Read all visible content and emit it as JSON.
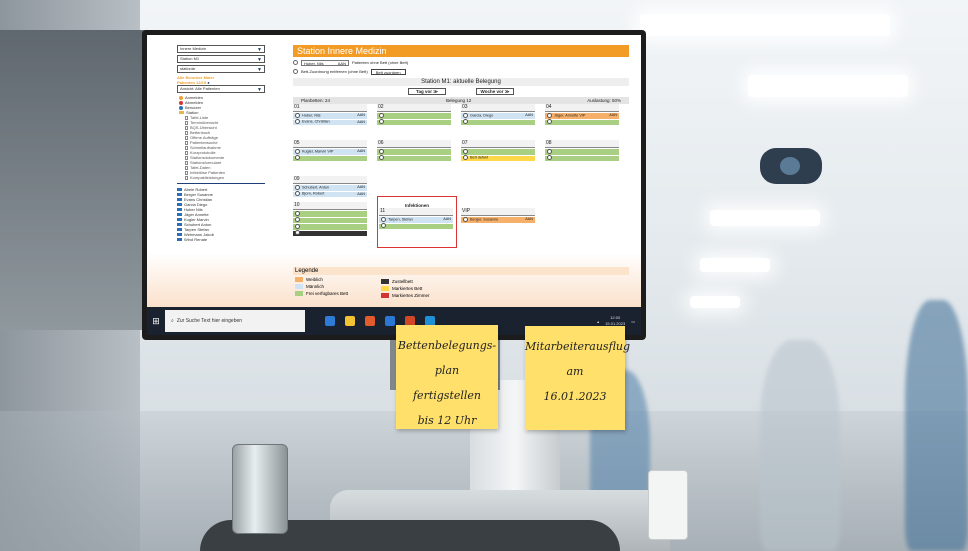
{
  "sidebar": {
    "select_1": "Innere Medizin",
    "select_2": "Station M1",
    "select_3": "stationär",
    "orange_line_1": "Alle Benutzer Maier",
    "orange_line_2": "Patienten 12/19",
    "select_4": "Ansicht: Alle Patienten",
    "tree": [
      {
        "label": "Anmelden",
        "type": "dot",
        "color": "#f0a030"
      },
      {
        "label": "Abmelden",
        "type": "dot",
        "color": "#d33"
      },
      {
        "label": "Benutzer",
        "type": "dot",
        "color": "#2c6fb7"
      },
      {
        "label": "Station",
        "type": "folder"
      },
      {
        "label": "Tafel-Liste",
        "type": "doc",
        "sub": true
      },
      {
        "label": "Terminübersicht",
        "type": "doc",
        "sub": true
      },
      {
        "label": "BQS-Übersicht",
        "type": "doc",
        "sub": true
      },
      {
        "label": "Bettenbuch",
        "type": "doc",
        "sub": true
      },
      {
        "label": "Offene Aufträge",
        "type": "doc",
        "sub": true
      },
      {
        "label": "Patientensuche",
        "type": "doc",
        "sub": true
      },
      {
        "label": "Schnellaufnahme",
        "type": "doc",
        "sub": true
      },
      {
        "label": "Kurzprotokolle",
        "type": "doc",
        "sub": true
      },
      {
        "label": "Stationsdokumente",
        "type": "doc",
        "sub": true
      },
      {
        "label": "Stationsformulare",
        "type": "doc",
        "sub": true
      },
      {
        "label": "Tafel-Daten",
        "type": "doc",
        "sub": true
      },
      {
        "label": "Infektiöse Patienten",
        "type": "doc",
        "sub": true
      },
      {
        "label": "Kompaktleistungen",
        "type": "doc",
        "sub": true
      }
    ],
    "patients": [
      "Abele Robert",
      "Berger Susanne",
      "Evans Christian",
      "Garcia Diego",
      "Huber Nils",
      "Jäger Annette",
      "Kugler Marvin",
      "Schubert Anton",
      "Tarpen Stefan",
      "Wehmann Jakob",
      "Wind Renate"
    ]
  },
  "main": {
    "title": "Station Innere Medizin",
    "radio_select": "Huber, Nils",
    "radio_select_code": "AAN",
    "radio_1_text": "Patienten ohne Bett (ohne Bett)",
    "radio_2_text": "Bett-Zuordnung entfernen (ohne Bett)",
    "assign_button": "Bett zuordnen",
    "ward_heading": "Station M1: aktuelle Belegung",
    "day_forward": "Tag vor ≫",
    "week_forward": "Woche vor ≫",
    "stats": {
      "planned": "Planbetten: 24",
      "occupancy": "Belegung 12",
      "utilization": "Auslastung: 50%"
    }
  },
  "rooms": [
    {
      "num": "01",
      "beds": [
        {
          "name": "Huber, Nils",
          "code": "AAN",
          "kind": "male"
        },
        {
          "name": "Evans, Christian",
          "code": "AAN",
          "kind": "male"
        }
      ]
    },
    {
      "num": "02",
      "beds": [
        {
          "name": "",
          "code": "",
          "kind": "free"
        },
        {
          "name": "",
          "code": "",
          "kind": "free"
        }
      ]
    },
    {
      "num": "03",
      "beds": [
        {
          "name": "Garcia, Diego",
          "code": "AAN",
          "kind": "male"
        },
        {
          "name": "",
          "code": "",
          "kind": "free"
        }
      ]
    },
    {
      "num": "04",
      "beds": [
        {
          "name": "Jäger, Annette VIP",
          "code": "AAN",
          "kind": "female"
        },
        {
          "name": "",
          "code": "",
          "kind": "free"
        }
      ]
    },
    {
      "num": "05",
      "beds": [
        {
          "name": "Kugler, Marvin VIP",
          "code": "AAN",
          "kind": "male"
        },
        {
          "name": "",
          "code": "",
          "kind": "free"
        }
      ]
    },
    {
      "num": "06",
      "beds": [
        {
          "name": "",
          "code": "",
          "kind": "free"
        },
        {
          "name": "",
          "code": "",
          "kind": "free"
        }
      ]
    },
    {
      "num": "07",
      "beds": [
        {
          "name": "",
          "code": "",
          "kind": "free"
        },
        {
          "name": "Bett defekt",
          "code": "",
          "kind": "marked"
        }
      ]
    },
    {
      "num": "08",
      "beds": [
        {
          "name": "",
          "code": "",
          "kind": "free"
        },
        {
          "name": "",
          "code": "",
          "kind": "free"
        }
      ]
    },
    {
      "num": "09",
      "beds": [
        {
          "name": "Schubert, Anton",
          "code": "AAN",
          "kind": "male"
        },
        {
          "name": "Bjorn, Robert",
          "code": "AAN",
          "kind": "male"
        }
      ]
    },
    {
      "num": "10",
      "beds": [
        {
          "name": "",
          "code": "",
          "kind": "free"
        },
        {
          "name": "",
          "code": "",
          "kind": "free"
        },
        {
          "name": "",
          "code": "",
          "kind": "free"
        },
        {
          "name": "",
          "code": "",
          "kind": "extra"
        }
      ]
    },
    {
      "num": "11",
      "beds": [
        {
          "name": "Tarpen, Stefan",
          "code": "AAN",
          "kind": "male"
        },
        {
          "name": "",
          "code": "",
          "kind": "free"
        }
      ]
    },
    {
      "num": "VIP",
      "beds": [
        {
          "name": "Berger, Susanne",
          "code": "AAN",
          "kind": "female"
        }
      ]
    }
  ],
  "infection_title": "Infektionen",
  "legend": {
    "title": "Legende",
    "items": [
      {
        "label": "Weiblich",
        "color": "#f7b06a"
      },
      {
        "label": "Männlich",
        "color": "#cfe3f2"
      },
      {
        "label": "Frei verfügbares Bett",
        "color": "#a9cf83"
      },
      {
        "label": "Zustellbett",
        "color": "#333333"
      },
      {
        "label": "Markiertes Bett",
        "color": "#ffd84a"
      },
      {
        "label": "Markiertes Zimmer",
        "color": "#d33333"
      }
    ]
  },
  "taskbar": {
    "search_placeholder": "Zur Suche Text hier eingeben",
    "time": "12:00",
    "date": "15.01.2023"
  },
  "notes": {
    "note1": [
      "Bettenbelegungs-",
      "plan",
      "fertigstellen",
      "bis 12 Uhr"
    ],
    "note2": [
      "Mitarbeiterausflug",
      "am",
      "16.01.2023"
    ]
  }
}
